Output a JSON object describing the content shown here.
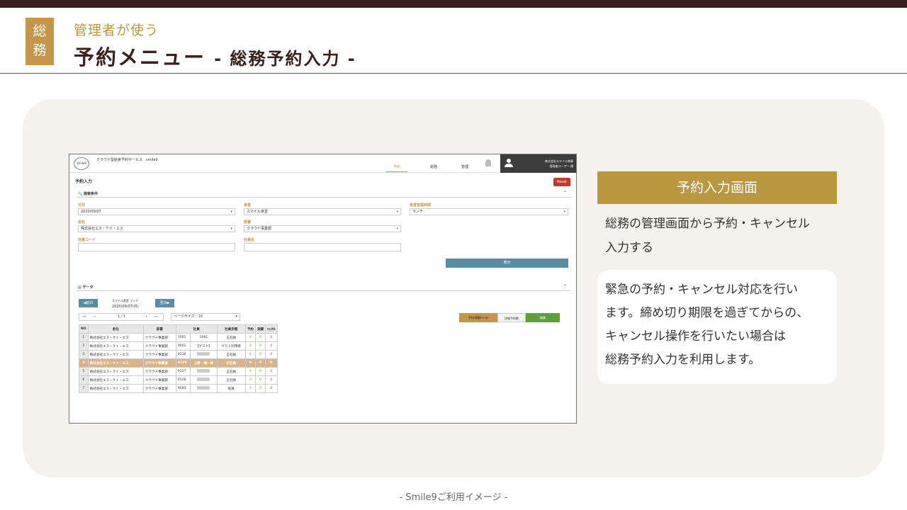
{
  "badge": {
    "line1": "総",
    "line2": "務"
  },
  "header": {
    "subtitle": "管理者が使う",
    "title": "予約メニュー",
    "title_suffix": "- 総務予約入力 -"
  },
  "app": {
    "logo_text": "Smile9",
    "service_name": "クラウド型給食予約サービス　smile9",
    "nav": {
      "reserve": "予約",
      "general": "総務",
      "admin": "管理"
    },
    "user": {
      "company": "株式会社スマイル商事",
      "name": "管理者ユーザー 様"
    },
    "page_name": "予約入力",
    "reset_label": "Reset",
    "search": {
      "section_label": "検索条件",
      "date_label": "日付",
      "date_value": "2020/09/07",
      "cafeteria_label": "食堂",
      "cafeteria_value": "スマイル食堂",
      "hours_label": "食堂営業時間",
      "hours_value": "ランチ",
      "company_label": "会社",
      "company_value": "株式会社エス・ケイ・エス",
      "dept_label": "部署",
      "dept_value": "クラウド事業部",
      "emp_code_label": "社員コード",
      "emp_code_value": "",
      "emp_name_label": "社員名",
      "emp_name_value": "",
      "show_label": "表示"
    },
    "data_section_label": "データ",
    "prev_day": "◀前日",
    "next_day": "翌日▶",
    "date_info": {
      "line1": "スマイル食堂 ランチ",
      "line2": "2020/09/07(月)"
    },
    "pager": {
      "page": "1 / 1",
      "first": "◂◂",
      "prev": "◂",
      "next": "▸",
      "last": "▸▸"
    },
    "page_size": "ページサイズ：10",
    "actions": {
      "reserve_cancel": "予約/実績/ｷｬﾝｾﾙ",
      "detail_count": "詳細予約数",
      "edit": "編集"
    },
    "table": {
      "headers": [
        "NO",
        "会社",
        "部署",
        "社員",
        "",
        "社員形態",
        "予約",
        "実績",
        "ｷｬﾝｾﾙ"
      ],
      "rows": [
        {
          "no": "1",
          "company": "株式会社エス・ケイ・エス",
          "dept": "クラウド事業部",
          "code": "1001",
          "name": "1001",
          "type": "正社員",
          "r": "0",
          "a": "0",
          "c": "0"
        },
        {
          "no": "2",
          "company": "株式会社エス・ケイ・エス",
          "dept": "クラウド事業部",
          "code": "9002",
          "name": "【ゲスト】",
          "type": "ゲスト利用者",
          "r": "0",
          "a": "0",
          "c": "0"
        },
        {
          "no": "3",
          "company": "株式会社エス・ケイ・エス",
          "dept": "クラウド事業部",
          "code": "9116",
          "name": "",
          "type": "正社員",
          "r": "0",
          "a": "0",
          "c": "0"
        },
        {
          "no": "4",
          "company": "株式会社エス・ケイ・エス",
          "dept": "クラウド事業部",
          "code": "9120",
          "name": "上野　順一郎",
          "type": "正社員",
          "r": "0",
          "a": "0",
          "c": "0"
        },
        {
          "no": "5",
          "company": "株式会社エス・ケイ・エス",
          "dept": "クラウド事業部",
          "code": "9127",
          "name": "",
          "type": "正社員",
          "r": "0",
          "a": "0",
          "c": "0"
        },
        {
          "no": "6",
          "company": "株式会社エス・ケイ・エス",
          "dept": "クラウド事業部",
          "code": "9128",
          "name": "",
          "type": "正社員",
          "r": "0",
          "a": "0",
          "c": "0"
        },
        {
          "no": "7",
          "company": "株式会社エス・ケイ・エス",
          "dept": "クラウド事業部",
          "code": "9083",
          "name": "",
          "type": "役員",
          "r": "0",
          "a": "0",
          "c": "0"
        }
      ]
    }
  },
  "side": {
    "title": "予約入力画面",
    "desc_line1": "総務の管理画面から予約・キャンセル",
    "desc_line2": "入力する",
    "note_line1": "緊急の予約・キャンセル対応を行い",
    "note_line2": "ます。締め切り期限を過ぎてからの、",
    "note_line3": "キャンセル操作を行いたい場合は",
    "note_line4": "総務予約入力を利用します。"
  },
  "footer": "- Smile9ご利用イメージ -"
}
